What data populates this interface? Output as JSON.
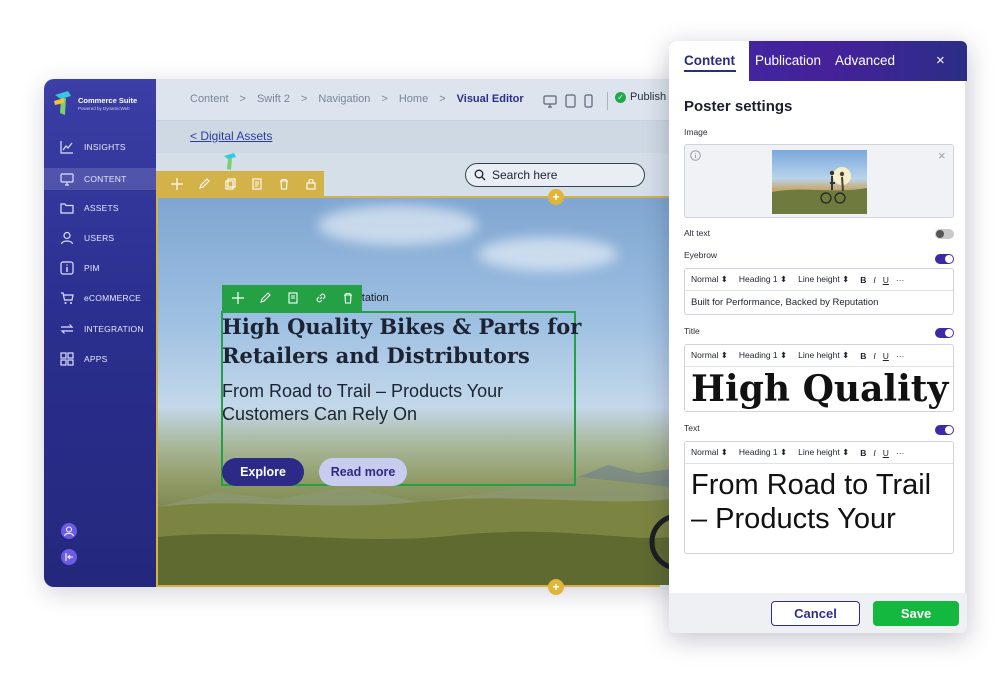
{
  "brand": {
    "name": "Commerce Suite",
    "tagline": "Powered by DynamicWeb"
  },
  "sidebar": {
    "items": [
      {
        "label": "INSIGHTS",
        "icon": "chart-icon"
      },
      {
        "label": "CONTENT",
        "icon": "monitor-icon",
        "active": true
      },
      {
        "label": "ASSETS",
        "icon": "folder-icon"
      },
      {
        "label": "USERS",
        "icon": "user-icon"
      },
      {
        "label": "PIM",
        "icon": "info-icon"
      },
      {
        "label": "eCOMMERCE",
        "icon": "cart-icon"
      },
      {
        "label": "INTEGRATION",
        "icon": "arrows-icon"
      },
      {
        "label": "APPS",
        "icon": "grid-icon"
      }
    ]
  },
  "breadcrumb": {
    "items": [
      "Content",
      ">",
      "Swift 2",
      ">",
      "Navigation",
      ">",
      "Home",
      ">"
    ],
    "current": "Visual Editor"
  },
  "status": {
    "label": "Publish"
  },
  "asset_link": "< Digital Assets",
  "site": {
    "search_placeholder": "Search here"
  },
  "hero": {
    "eyebrow": "ced by Reputation",
    "title": "High Quality Bikes & Parts for Retailers and Distributors",
    "subtitle": "From Road to Trail – Products Your Customers Can Rely On",
    "explore": "Explore",
    "read_more": "Read more"
  },
  "panel": {
    "tabs": [
      "Content",
      "Publication",
      "Advanced"
    ],
    "close": "×",
    "heading": "Poster settings",
    "image_label": "Image",
    "alt_label": "Alt text",
    "eyebrow_label": "Eyebrow",
    "eyebrow_value": "Built for Performance, Backed by Reputation",
    "title_label": "Title",
    "title_value": "High Quality",
    "text_label": "Text",
    "text_value": "From Road to Trail – Products Your",
    "toolbar": {
      "style": "Normal",
      "heading": "Heading 1",
      "line_height": "Line height",
      "bold": "B",
      "italic": "I",
      "underline": "U",
      "more": "···"
    },
    "cancel": "Cancel",
    "save": "Save"
  },
  "colors": {
    "primary": "#2c2a86",
    "accent_green": "#14b83e",
    "edit_yellow": "#d4b24a",
    "sidebar": "#2b2f8f"
  }
}
